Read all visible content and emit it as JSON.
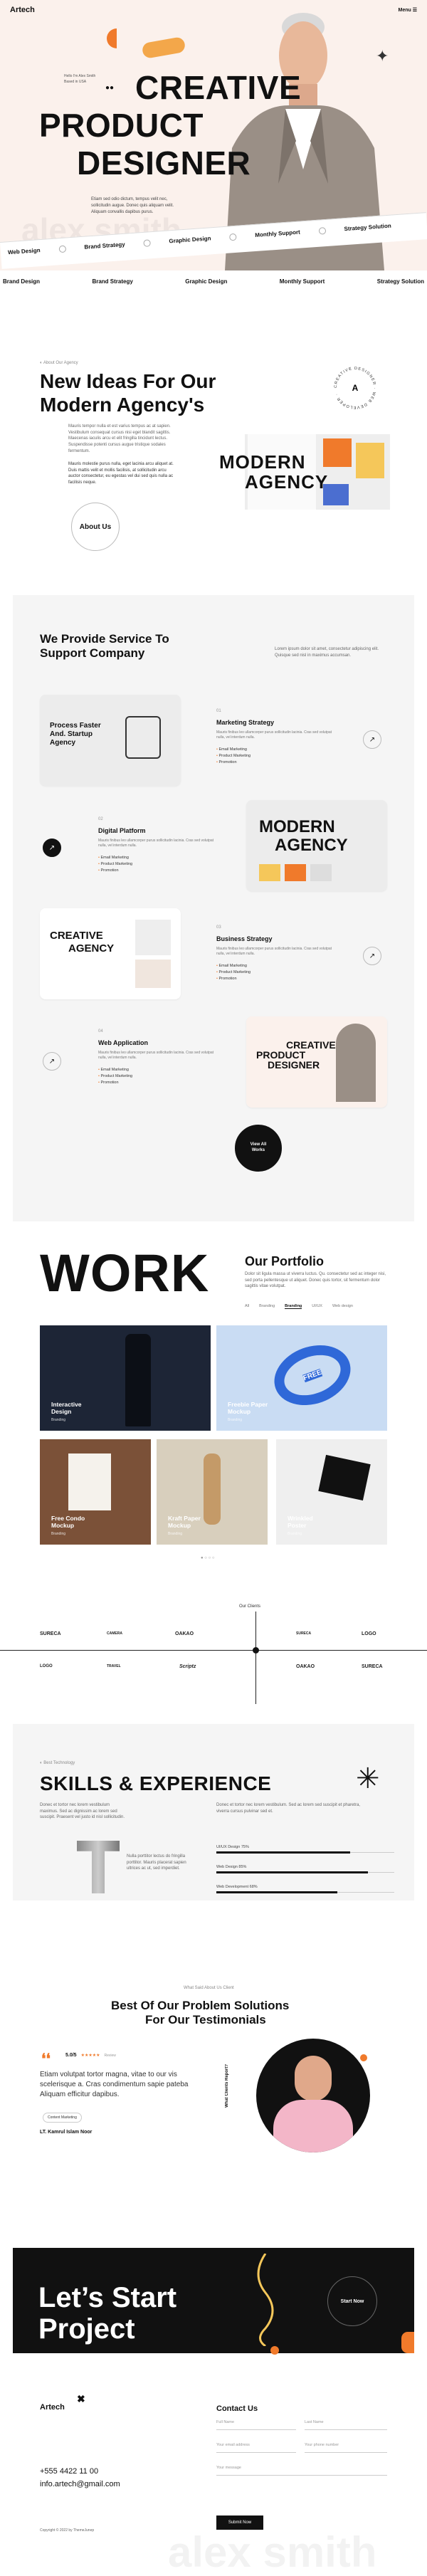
{
  "header": {
    "logo": "Artech",
    "menu": "Menu"
  },
  "hero": {
    "hello": "Hello I'm Alex Smith Based in USA",
    "line1": "CREATIVE",
    "line2": "PRODUCT",
    "line3": "DESIGNER",
    "intro": "Etiam sed odio dictum, tempus velit nec, sollicitudin augue. Donec quis aliquam velit. Aliquam convallis dapibus purus.",
    "watermark": "alex smith",
    "marquee": [
      "Web Design",
      "Brand Strategy",
      "Graphic Design",
      "Monthly Support",
      "Strategy Solution"
    ],
    "strip": [
      "Brand Design",
      "Brand Strategy",
      "Graphic Design",
      "Monthly Support",
      "Strategy Solution"
    ]
  },
  "about": {
    "label": "About Our Agency",
    "title1": "New Ideas For Our",
    "title2": "Modern Agency's",
    "para1": "Mauris tempor nulla et est varius tempus ac at sapien. Vestibulum consequat cursus nisi eget blandit sagittis. Maecenas iaculis arcu et elit fringilla tincidunt lectus. Suspendisse potenti cursus augue tristique sodales fermentum.",
    "para2": "Mauris molestie purus nulla, eget lacinia arcu aliquet at. Duis mattis velit et mollis facilisis, at sollicitudin arcu auctor consectetur, eu egestas vel dui sed quis nulla ac facilisis neque.",
    "btn": "About Us",
    "badge": "CREATIVE DESIGNER · WEB DEVELOPER ·",
    "badge_icon": "A",
    "img_text1": "MODERN",
    "img_text2": "AGENCY"
  },
  "services": {
    "title1": "We Provide Service To",
    "title2": "Support Company",
    "intro": "Lorem ipsum dolor sit amet, consectetur adipiscing elit. Quisque sed nisl in maximus accumsan.",
    "items": [
      {
        "num": "01",
        "title": "Marketing Strategy",
        "desc": "Mauris finibus leo ullamcorper purus sollicitudin lacinia. Cras sed volutpat nulla, vel interdum nulla.",
        "list": [
          "Email Marketing",
          "Product Marketing",
          "Promotion"
        ]
      },
      {
        "num": "02",
        "title": "Digital Platform",
        "desc": "Mauris finibus leo ullamcorper purus sollicitudin lacinia. Cras sed volutpat nulla, vel interdum nulla.",
        "list": [
          "Email Marketing",
          "Product Marketing",
          "Promotion"
        ]
      },
      {
        "num": "03",
        "title": "Business Strategy",
        "desc": "Mauris finibus leo ullamcorper purus sollicitudin lacinia. Cras sed volutpat nulla, vel interdum nulla.",
        "list": [
          "Email Marketing",
          "Product Marketing",
          "Promotion"
        ]
      },
      {
        "num": "04",
        "title": "Web Application",
        "desc": "Mauris finibus leo ullamcorper purus sollicitudin lacinia. Cras sed volutpat nulla, vel interdum nulla.",
        "list": [
          "Email Marketing",
          "Product Marketing",
          "Promotion"
        ]
      }
    ],
    "card1_title": "Process Faster And. Startup Agency",
    "card2_title1": "MODERN",
    "card2_title2": "AGENCY",
    "card3_title1": "CREATIVE",
    "card3_title2": "AGENCY",
    "card4_title1": "CREATIVE",
    "card4_title2": "PRODUCT",
    "card4_title3": "DESIGNER",
    "view_all": "View All Works"
  },
  "work": {
    "big": "WORK",
    "title": "Our Portfolio",
    "desc": "Dolor sit ligula massa ut viverra luctus. Qu. consectetur sed ac integer nisi, sed porta pellentesque ut aliquet. Donec quis tortor, sit fermentum dolor sagittis vitae volutpat.",
    "filters": [
      "All",
      "Branding",
      "Branding",
      "UI/UX",
      "Web design"
    ],
    "items": [
      {
        "title": "Interactive Design",
        "tag": "Branding"
      },
      {
        "title": "Freebie Paper Mockup",
        "tag": "Branding"
      },
      {
        "title": "Free Condo Mockup",
        "tag": "Branding"
      },
      {
        "title": "Kraft Paper Mockup",
        "tag": "Branding"
      },
      {
        "title": "Wrinkled Poster",
        "tag": "Branding"
      }
    ],
    "img2_label": "FREE",
    "pager": "● ○ ○ ○"
  },
  "clients": {
    "label": "Our Clients",
    "logos": [
      "SURECA",
      "CAMERA",
      "OAKAO",
      "SURECA",
      "LOGO",
      "LOGO",
      "TRAVEL",
      "Scriptz",
      "OAKAO",
      "SURECA"
    ]
  },
  "skills": {
    "label": "Best Technology",
    "title": "SKILLS & EXPERIENCE",
    "para": "Donec et tortor nec lorem vestibulum maximus. Sed ac dignissim ac lorem sed suscipit. Praesent vel justo id nisl sollicitudin.",
    "para2": "Donec et tortor nec lorem vestibulum. Sed ac lorem sed suscipit et pharetra, viverra cursus pulvinar sed et.",
    "caption": "Nulla porttitor lectus do fringilla porttitor. Mauris placerat sapien ultrices ac ut, sed imperdiet.",
    "bars": [
      {
        "label": "UI/UX Design 75%",
        "pct": 0.75
      },
      {
        "label": "Web Design 85%",
        "pct": 0.85
      },
      {
        "label": "Web Development 68%",
        "pct": 0.68
      }
    ],
    "asterisk": "✳"
  },
  "testimonials": {
    "label": "What Said About Us Client",
    "title1": "Best Of Our Problem Solutions",
    "title2": "For Our Testimonials",
    "rating": "5.0/5",
    "stars": "★★★★★",
    "review_label": "Review",
    "quote": "Etiam volutpat tortor magna, vitae to our vis scelerisque a. Cras condimentum sapie pateba Aliquam efficitur dapibus.",
    "role": "Content Marketing",
    "author": "LT. Kamrul Islam Noor",
    "side": "What Clients Report?"
  },
  "cta": {
    "line1": "Let’s Start",
    "line2": "Project",
    "btn": "Start Now",
    "accent": "#f07a2b"
  },
  "footer": {
    "logo": "Artech",
    "phone": "+555 4422 11 00",
    "email": "info.artech@gmail.com",
    "copy": "Copyright © 2022 by ThemeJunep",
    "contact_title": "Contact Us",
    "fields": [
      "Full Name",
      "Last Name",
      "Your email address",
      "Your phone number",
      "Your message"
    ],
    "submit": "Submit Now",
    "watermark": "alex smith"
  }
}
